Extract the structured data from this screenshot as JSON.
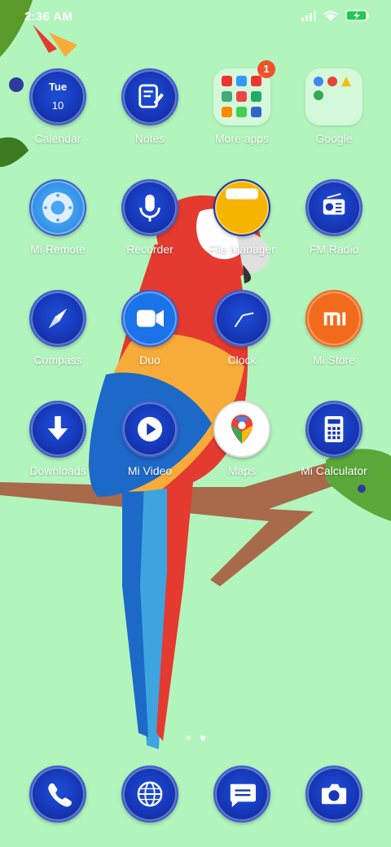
{
  "status_bar": {
    "time": "2:36 AM",
    "icons": [
      "signal-icon",
      "wifi-icon",
      "battery-charging-icon"
    ]
  },
  "home_rows": [
    [
      {
        "label": "Calendar",
        "icon": "calendar-icon",
        "day": "Tue",
        "date": "10"
      },
      {
        "label": "Notes",
        "icon": "notes-icon"
      },
      {
        "label": "More apps",
        "icon": "folder-icon",
        "badge": "1"
      },
      {
        "label": "Google",
        "icon": "folder-icon"
      }
    ],
    [
      {
        "label": "Mi Remote",
        "icon": "remote-icon"
      },
      {
        "label": "Recorder",
        "icon": "microphone-icon"
      },
      {
        "label": "File Manager",
        "icon": "folder-yellow-icon"
      },
      {
        "label": "FM Radio",
        "icon": "radio-icon"
      }
    ],
    [
      {
        "label": "Compass",
        "icon": "compass-icon"
      },
      {
        "label": "Duo",
        "icon": "video-camera-icon"
      },
      {
        "label": "Clock",
        "icon": "clock-icon"
      },
      {
        "label": "Mi Store",
        "icon": "mi-logo-icon"
      }
    ],
    [
      {
        "label": "Downloads",
        "icon": "download-arrow-icon"
      },
      {
        "label": "Mi Video",
        "icon": "play-icon"
      },
      {
        "label": "Maps",
        "icon": "map-pin-icon"
      },
      {
        "label": "Mi Calculator",
        "icon": "calculator-icon"
      }
    ]
  ],
  "page_indicator": {
    "pages": 2,
    "active": 2
  },
  "dock": [
    {
      "name": "phone",
      "icon": "phone-icon"
    },
    {
      "name": "browser",
      "icon": "globe-icon"
    },
    {
      "name": "messages",
      "icon": "message-icon"
    },
    {
      "name": "camera",
      "icon": "camera-icon"
    }
  ],
  "colors": {
    "wallpaper": "#b1f5bc",
    "icon_blue": "#1637b8",
    "mi_orange": "#f26b1d",
    "file_manager_yellow": "#f4b400",
    "badge": "#f0522a"
  }
}
